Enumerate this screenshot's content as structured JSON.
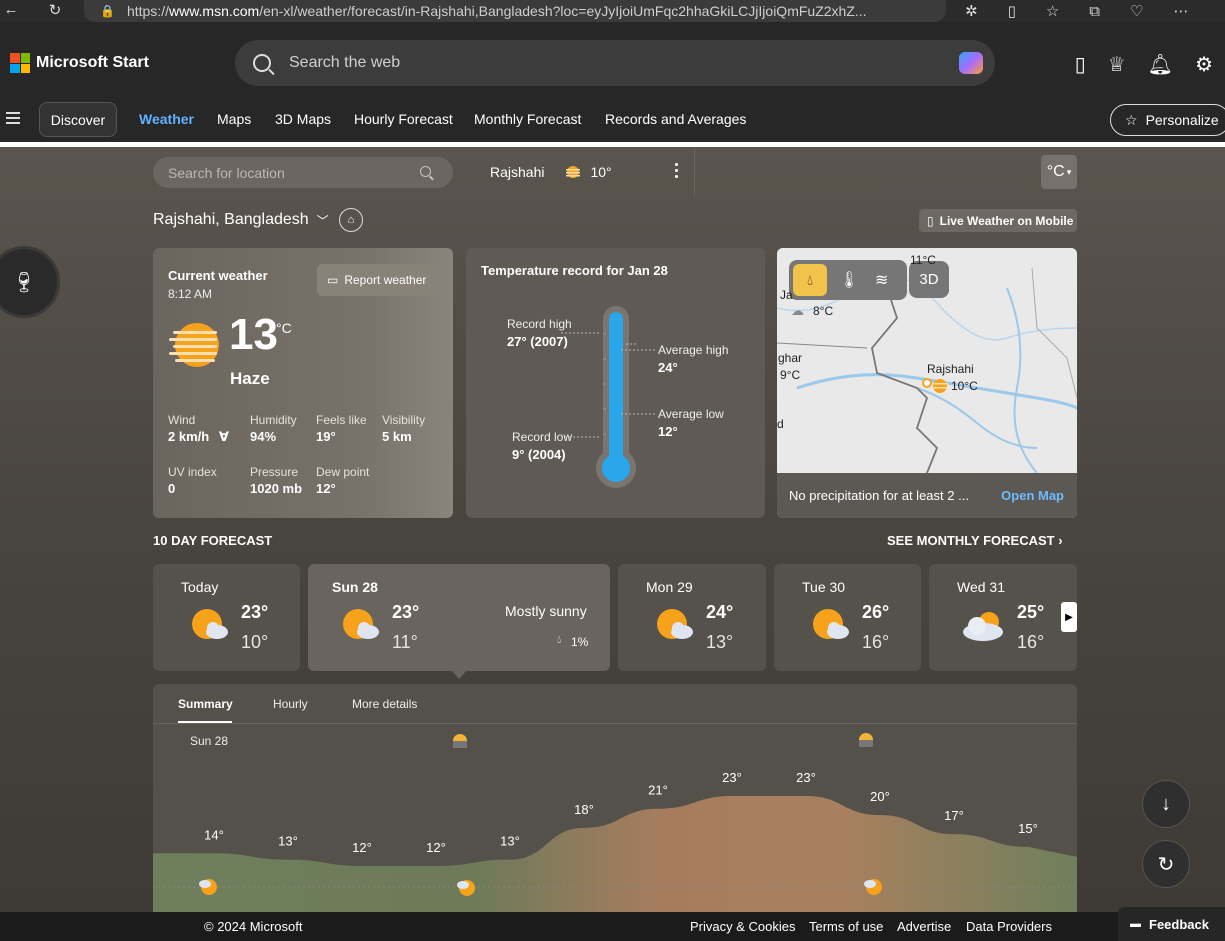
{
  "browser": {
    "url_prefix": "https://",
    "url_host": "www.msn.com",
    "url_rest": "/en-xl/weather/forecast/in-Rajshahi,Bangladesh?loc=eyJyIjoiUmFqc2hhaGkiLCJjIjoiQmFuZ2xhZ..."
  },
  "header": {
    "brand": "Microsoft Start",
    "search_placeholder": "Search the web",
    "nav": {
      "discover": "Discover",
      "links": [
        "Weather",
        "Maps",
        "3D Maps",
        "Hourly Forecast",
        "Monthly Forecast",
        "Records and Averages"
      ],
      "personalize": "Personalize"
    }
  },
  "weather_bar": {
    "location_placeholder": "Search for location",
    "fav_location": "Rajshahi",
    "fav_temp": "10°",
    "unit": "°C",
    "location_name": "Rajshahi, Bangladesh",
    "live_mobile": "Live Weather on Mobile"
  },
  "current": {
    "title": "Current weather",
    "time": "8:12 AM",
    "report": "Report weather",
    "temp": "13",
    "unit": "°C",
    "condition": "Haze",
    "metrics": [
      {
        "label": "Wind",
        "value": "2 km/h"
      },
      {
        "label": "Humidity",
        "value": "94%"
      },
      {
        "label": "Feels like",
        "value": "19°"
      },
      {
        "label": "Visibility",
        "value": "5 km"
      },
      {
        "label": "UV index",
        "value": "0"
      },
      {
        "label": "Pressure",
        "value": "1020 mb"
      },
      {
        "label": "Dew point",
        "value": "12°"
      }
    ]
  },
  "record": {
    "title": "Temperature record for Jan 28",
    "record_high_label": "Record high",
    "record_high_value": "27° (2007)",
    "record_low_label": "Record low",
    "record_low_value": "9° (2004)",
    "avg_high_label": "Average high",
    "avg_high_value": "24°",
    "avg_low_label": "Average low",
    "avg_low_value": "12°"
  },
  "map": {
    "btn_3d": "3D",
    "labels": [
      {
        "name": "Rajshahi",
        "temp": "10°C"
      },
      {
        "name": "Ja",
        "temp": "8°C"
      },
      {
        "name": "ghar",
        "temp": "9°C"
      },
      {
        "name": "d",
        "temp": ""
      },
      {
        "name": "",
        "temp": "11°C"
      }
    ],
    "footer_text": "No precipitation for at least 2 ...",
    "open_map": "Open Map"
  },
  "forecast": {
    "title": "10 DAY FORECAST",
    "see_monthly": "SEE MONTHLY FORECAST",
    "days": [
      {
        "name": "Today",
        "hi": "23°",
        "lo": "10°",
        "icon": "partly-sunny-icon"
      },
      {
        "name": "Sun 28",
        "hi": "23°",
        "lo": "11°",
        "icon": "partly-sunny-icon",
        "desc": "Mostly sunny",
        "precip": "1%"
      },
      {
        "name": "Mon 29",
        "hi": "24°",
        "lo": "13°",
        "icon": "partly-sunny-icon"
      },
      {
        "name": "Tue 30",
        "hi": "26°",
        "lo": "16°",
        "icon": "partly-sunny-icon"
      },
      {
        "name": "Wed 31",
        "hi": "25°",
        "lo": "16°",
        "icon": "cloudy-icon"
      }
    ]
  },
  "chart_tabs": [
    "Summary",
    "Hourly",
    "More details"
  ],
  "chart_date": "Sun 28",
  "chart_data": {
    "type": "area",
    "values": [
      14,
      13,
      12,
      12,
      13,
      18,
      21,
      23,
      23,
      20,
      17,
      15
    ],
    "labels": [
      "14°",
      "13°",
      "12°",
      "12°",
      "13°",
      "18°",
      "21°",
      "23°",
      "23°",
      "20°",
      "17°",
      "15°"
    ]
  },
  "footer": {
    "copyright": "© 2024 Microsoft",
    "links": [
      "Privacy & Cookies",
      "Terms of use",
      "Advertise",
      "Data Providers"
    ],
    "feedback": "Feedback"
  }
}
